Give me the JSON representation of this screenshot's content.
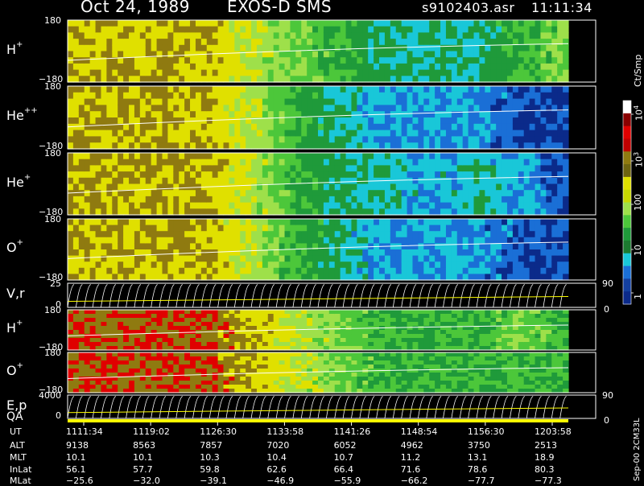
{
  "header": {
    "date_label": "Oct 24, 1989",
    "instrument_label": "EXOS-D SMS",
    "file_label": "s9102403.asr",
    "time_label": "11:11:34"
  },
  "colors": {
    "background": "#000000",
    "trace": "#ffffff",
    "energy_line": "#ffff00"
  },
  "panels": [
    {
      "id": "h_plus_1",
      "label": "H",
      "sup": "+",
      "ymax": "180",
      "ymin": "−180"
    },
    {
      "id": "he_pp",
      "label": "He",
      "sup": "++",
      "ymax": "180",
      "ymin": "−180"
    },
    {
      "id": "he_plus",
      "label": "He",
      "sup": "+",
      "ymax": "180",
      "ymin": "−180"
    },
    {
      "id": "o_plus_1",
      "label": "O",
      "sup": "+",
      "ymax": "180",
      "ymin": "−180"
    },
    {
      "id": "vr",
      "label": "V,r",
      "ymax": "25",
      "ymin": "0",
      "right_top": "90",
      "right_bottom": "0"
    },
    {
      "id": "h_plus_2",
      "label": "H",
      "sup": "+",
      "ymax": "180",
      "ymin": "−180"
    },
    {
      "id": "o_plus_2",
      "label": "O",
      "sup": "+",
      "ymax": "180",
      "ymin": "−180"
    },
    {
      "id": "ep",
      "label": "E,p",
      "ymax": "4000",
      "ymin": "0",
      "right_top": "90",
      "right_bottom": "0"
    }
  ],
  "qa_label": "QA",
  "colorbar": {
    "unit_label": "Ct/Smp",
    "tick_labels": [
      "10",
      "10",
      "100",
      "10",
      "1"
    ],
    "tick_sup": [
      "4",
      "3",
      "",
      "",
      ""
    ]
  },
  "footer": {
    "row_labels": [
      "UT",
      "ALT",
      "MLT",
      "InLat",
      "MLat"
    ],
    "columns": [
      [
        "1111:34",
        "9138",
        "10.1",
        "56.1",
        "−25.6"
      ],
      [
        "1119:02",
        "8563",
        "10.1",
        "57.7",
        "−32.0"
      ],
      [
        "1126:30",
        "7857",
        "10.3",
        "59.8",
        "−39.1"
      ],
      [
        "1133:58",
        "7020",
        "10.4",
        "62.6",
        "−46.9"
      ],
      [
        "1141:26",
        "6052",
        "10.7",
        "66.4",
        "−55.9"
      ],
      [
        "1148:54",
        "4962",
        "11.2",
        "71.6",
        "−66.2"
      ],
      [
        "1156:30",
        "3750",
        "13.1",
        "78.6",
        "−77.7"
      ],
      [
        "1203:58",
        "2513",
        "18.9",
        "80.3",
        "−77.3"
      ]
    ],
    "version_label": "Sep-00 2CM33L"
  },
  "chart_data": {
    "type": "heatmap",
    "x_ticks": [
      "1111:34",
      "1119:02",
      "1126:30",
      "1133:58",
      "1141:26",
      "1148:54",
      "1156:30",
      "1203:58"
    ],
    "colorscale": [
      {
        "level": 1,
        "color": "#0b2a8a"
      },
      {
        "level": 5,
        "color": "#1a6fd6"
      },
      {
        "level": 10,
        "color": "#19c7d8"
      },
      {
        "level": 20,
        "color": "#1f9a3a"
      },
      {
        "level": 50,
        "color": "#4cc73a"
      },
      {
        "level": 100,
        "color": "#9ee04a"
      },
      {
        "level": 200,
        "color": "#e0e000"
      },
      {
        "level": 500,
        "color": "#8f7a10"
      },
      {
        "level": 1000,
        "color": "#e00000"
      },
      {
        "level": 5000,
        "color": "#8a0000"
      },
      {
        "level": 10000,
        "color": "#ffffff"
      }
    ],
    "panel_profiles": {
      "h_plus_1": [
        500,
        500,
        500,
        500,
        200,
        100,
        50,
        20,
        20,
        20,
        50,
        100
      ],
      "he_pp": [
        500,
        500,
        500,
        500,
        200,
        50,
        20,
        10,
        10,
        10,
        5,
        5
      ],
      "he_plus": [
        500,
        500,
        500,
        500,
        200,
        50,
        20,
        20,
        10,
        20,
        10,
        5
      ],
      "o_plus_1": [
        500,
        500,
        500,
        500,
        200,
        50,
        20,
        10,
        10,
        10,
        5,
        5
      ],
      "h_plus_2": [
        1000,
        1000,
        1000,
        1000,
        500,
        200,
        100,
        50,
        50,
        50,
        100,
        50
      ],
      "o_plus_2": [
        1000,
        1000,
        1000,
        1000,
        500,
        200,
        100,
        50,
        50,
        50,
        50,
        50
      ]
    }
  }
}
